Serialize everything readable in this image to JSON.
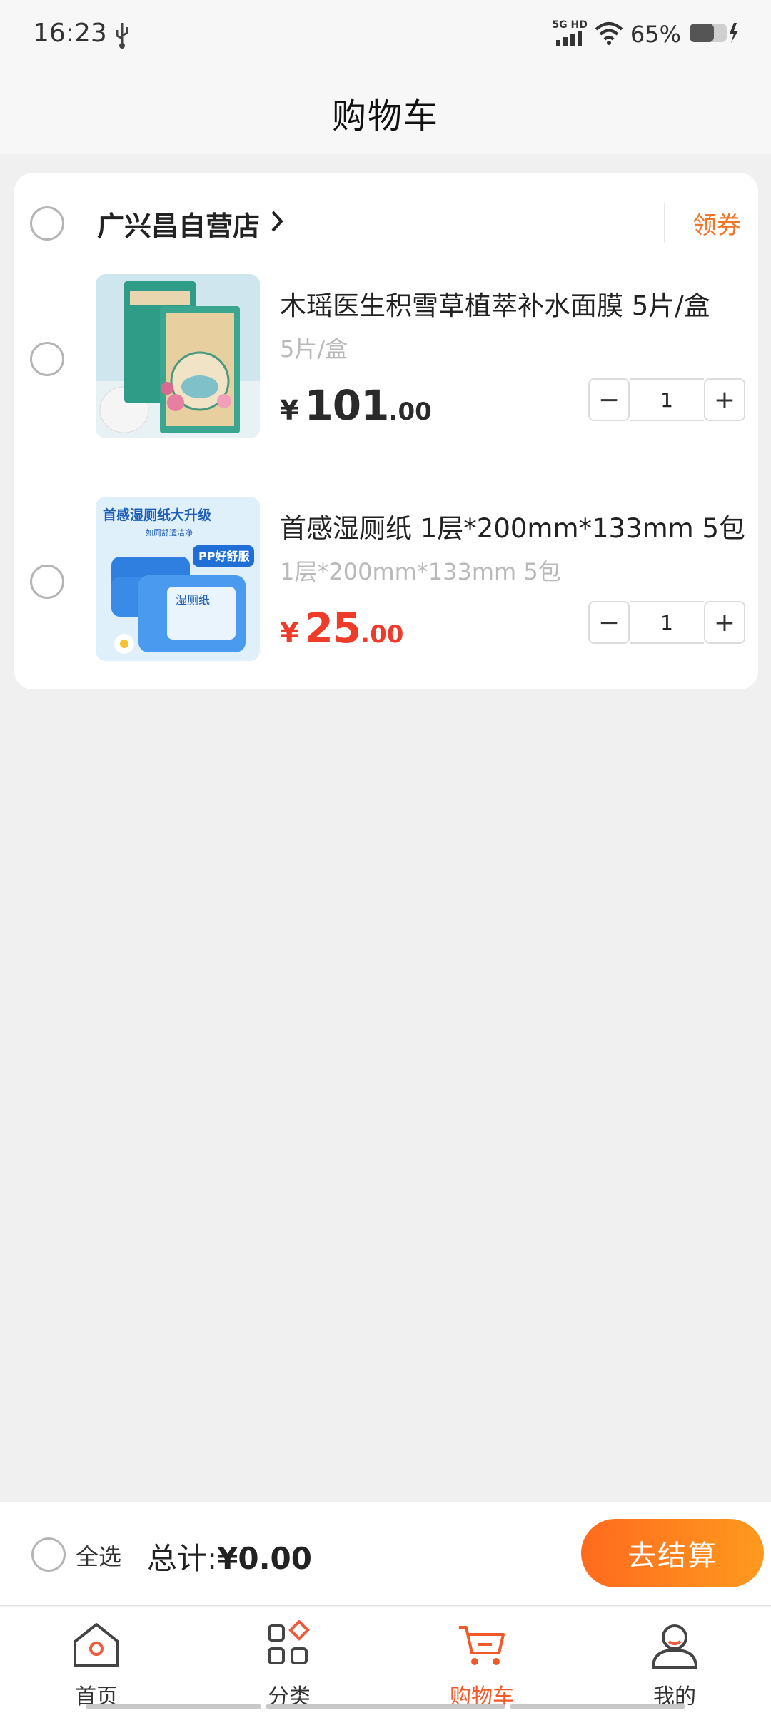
{
  "status_bar": {
    "time": "16:23",
    "network_label": "5G HD",
    "battery_percent": "65%",
    "battery_level": 0.65
  },
  "header": {
    "title": "购物车"
  },
  "cart": {
    "store": {
      "name": "广兴昌自营店",
      "coupon_label": "领券"
    },
    "items": [
      {
        "name": "木瑶医生积雪草植萃补水面膜 5片/盒",
        "spec": "5片/盒",
        "price_symbol": "¥",
        "price_int": "101",
        "price_dec": ".00",
        "quantity": "1",
        "price_color": "#2a2a2a"
      },
      {
        "name": "首感湿厕纸 1层*200mm*133mm 5包",
        "spec": "1层*200mm*133mm 5包",
        "price_symbol": "¥",
        "price_int": "25",
        "price_dec": ".00",
        "quantity": "1",
        "price_color": "#ef3b2a",
        "image_text": {
          "headline": "首感湿厕纸大升级",
          "subline": "如厕舒适洁净",
          "badge": "PP好舒服",
          "pack": "湿厕纸"
        }
      }
    ],
    "stepper": {
      "minus": "−",
      "plus": "+"
    }
  },
  "checkout": {
    "select_all_label": "全选",
    "total_label": "总计:",
    "total_value": "¥0.00",
    "button_label": "去结算"
  },
  "tabbar": {
    "tabs": [
      {
        "label": "首页",
        "icon": "home-icon",
        "active": false
      },
      {
        "label": "分类",
        "icon": "category-icon",
        "active": false
      },
      {
        "label": "购物车",
        "icon": "cart-icon",
        "active": true
      },
      {
        "label": "我的",
        "icon": "user-icon",
        "active": false
      }
    ]
  },
  "colors": {
    "accent": "#f05a2a",
    "price_red": "#ef3b2a",
    "coupon": "#f07528",
    "checkout_gradient_start": "#ff6a1e",
    "checkout_gradient_end": "#ff9a1e"
  }
}
